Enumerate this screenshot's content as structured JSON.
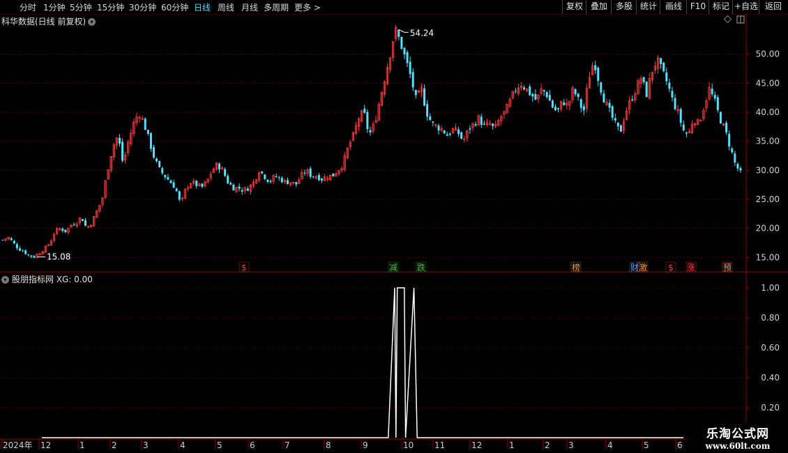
{
  "toolbar": {
    "periods": [
      "分时",
      "1分钟",
      "5分钟",
      "15分钟",
      "30分钟",
      "60分钟",
      "日线",
      "周线",
      "月线",
      "多周期",
      "更多 >"
    ],
    "active_period": "日线",
    "buttons": [
      "复权",
      "叠加",
      "多股",
      "统计",
      "画线",
      "F10",
      "标记",
      "+自选",
      "返回"
    ]
  },
  "chart_title": "科华数据(日线 前复权)",
  "indicator_title": "股朋指标网 XG: 0.00",
  "logo": {
    "brand": "乐淘公式网",
    "url": "www.60lt.com"
  },
  "colors": {
    "up": "#ff3b3b",
    "down": "#54e0ff",
    "grid": "#5a0000",
    "axis": "#8b0000",
    "line": "#ffffff"
  },
  "chart_data": [
    {
      "type": "candlestick",
      "title": "科华数据(日线 前复权)",
      "ylim": [
        13,
        55
      ],
      "y_ticks": [
        "15.00",
        "20.00",
        "25.00",
        "30.00",
        "35.00",
        "40.00",
        "45.00",
        "50.00"
      ],
      "x_ticks": [
        "2024年",
        "12",
        "1",
        "2",
        "3",
        "4",
        "5",
        "6",
        "7",
        "8",
        "9",
        "10",
        "11",
        "12",
        "1",
        "2",
        "3",
        "4",
        "5",
        "6"
      ],
      "annotations": [
        {
          "label": "54.24",
          "value": 54.24
        },
        {
          "label": "15.08",
          "value": 15.08
        }
      ],
      "event_markers": [
        {
          "label": "$",
          "color": "#ff3b3b"
        },
        {
          "label": "减",
          "color": "#3bd13b"
        },
        {
          "label": "跌",
          "color": "#3bd13b"
        },
        {
          "label": "榜",
          "color": "#ff9a3b"
        },
        {
          "label": "财",
          "color": "#54a8ff"
        },
        {
          "label": "激",
          "color": "#ff9a3b"
        },
        {
          "label": "$",
          "color": "#ff3b3b"
        },
        {
          "label": "涨",
          "color": "#ff3b3b"
        },
        {
          "label": "预",
          "color": "#ff9a3b"
        }
      ],
      "close_path": [
        18,
        18.5,
        17.5,
        16.5,
        16,
        15.3,
        15.08,
        15.8,
        16.5,
        17.5,
        19.5,
        20,
        19.5,
        20.5,
        21,
        22,
        20,
        21,
        23,
        25,
        30,
        34,
        36,
        31,
        35,
        38,
        40,
        38,
        35,
        32,
        30,
        29,
        28,
        27,
        24,
        27,
        28,
        27.5,
        27,
        28,
        30,
        31,
        30,
        28,
        27,
        27,
        26.5,
        27,
        28,
        30,
        29,
        28,
        29,
        28.5,
        28,
        28,
        27.5,
        29,
        30,
        29,
        29,
        28.5,
        29,
        29,
        30,
        31,
        34,
        36,
        39,
        40,
        36,
        38,
        42,
        46,
        50,
        54.24,
        52,
        49,
        46,
        42,
        44,
        40,
        38,
        37.5,
        37,
        36,
        37,
        36.5,
        35,
        37,
        38,
        39,
        37.5,
        38,
        37,
        39,
        40,
        42,
        44,
        45,
        44,
        43,
        42,
        44,
        43,
        41,
        40,
        42,
        41,
        44,
        42,
        40,
        46,
        49,
        45,
        42,
        40,
        38,
        36.5,
        40,
        42,
        44,
        46,
        43,
        47,
        49,
        47,
        45,
        42,
        40,
        37,
        36,
        39,
        38,
        41,
        44,
        42,
        39,
        37,
        34,
        31,
        29.5
      ]
    },
    {
      "type": "line",
      "title": "股朋指标网 XG: 0.00",
      "ylim": [
        0,
        1
      ],
      "y_ticks": [
        "0.20",
        "0.40",
        "0.60",
        "0.80",
        "1.00"
      ],
      "series": [
        {
          "name": "XG",
          "x": [
            0,
            0.54,
            0.55,
            0.552,
            0.554,
            0.56,
            0.565,
            0.567,
            0.58,
            0.585,
            1
          ],
          "values": [
            0,
            0,
            1,
            0,
            1,
            1,
            1,
            0,
            1,
            0,
            0
          ]
        }
      ]
    }
  ]
}
